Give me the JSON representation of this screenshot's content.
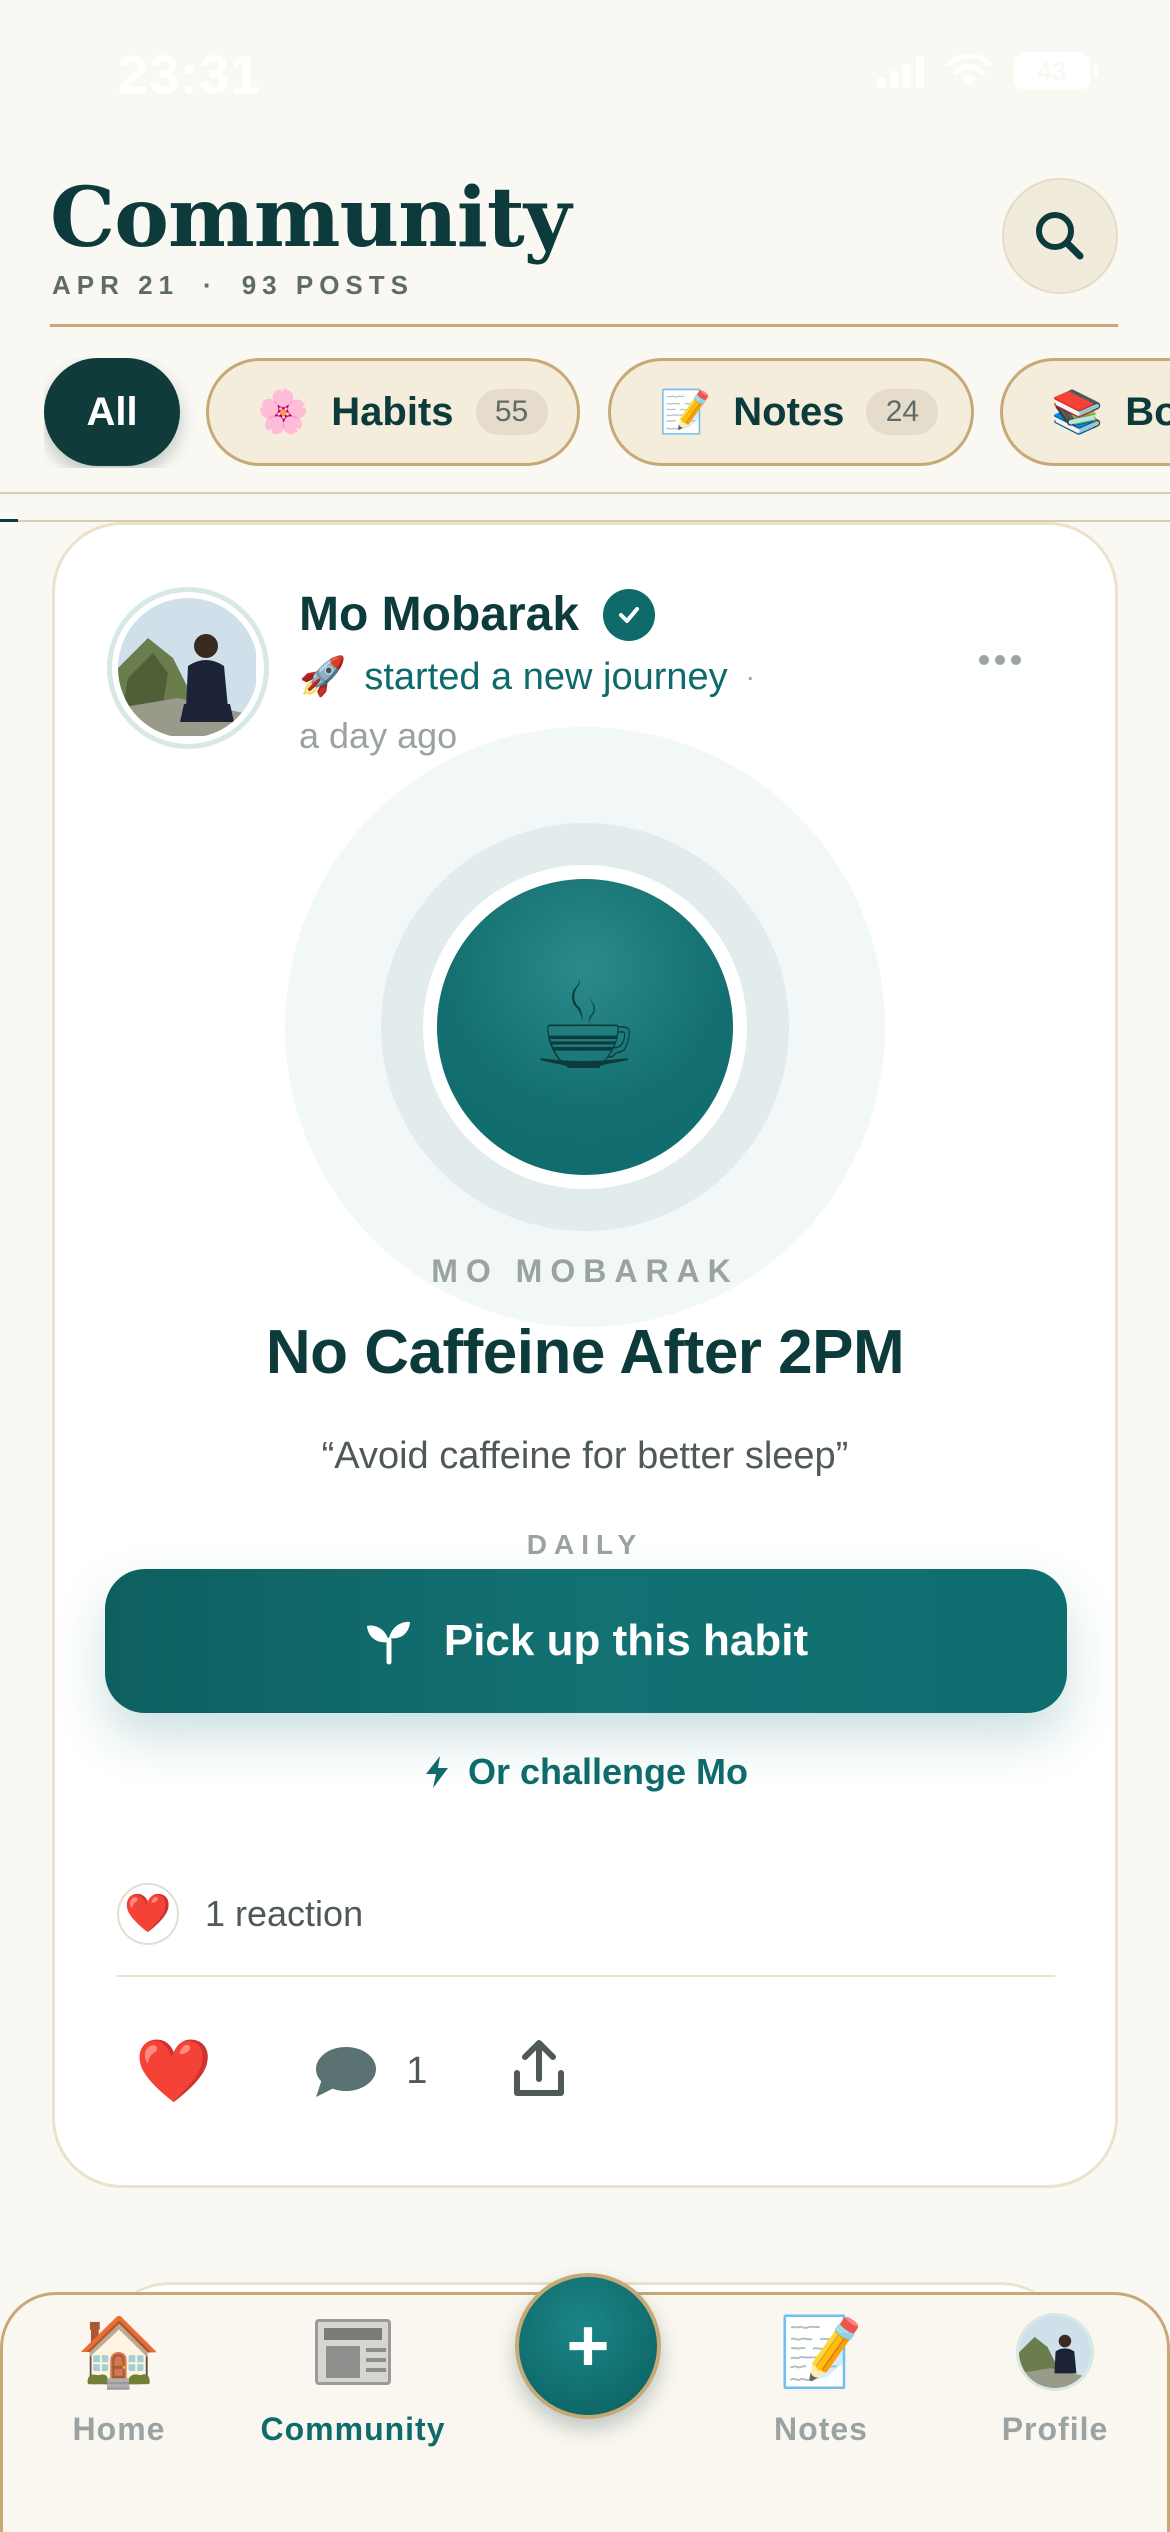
{
  "status_bar": {
    "time": "23:31",
    "battery": "43"
  },
  "header": {
    "title": "Community",
    "date": "APR 21",
    "separator": "·",
    "posts": "93 POSTS"
  },
  "filters": [
    {
      "label": "All",
      "active": true
    },
    {
      "label": "Habits",
      "emoji": "🌸",
      "count": "55"
    },
    {
      "label": "Notes",
      "emoji": "📝",
      "count": "24"
    },
    {
      "label": "Boo",
      "emoji": "📚"
    }
  ],
  "post": {
    "author": "Mo Mobarak",
    "activity_emoji": "🚀",
    "activity": "started a new journey",
    "activity_dot": "·",
    "time_ago": "a day ago",
    "habit": {
      "emoji": "☕",
      "owner": "MO MOBARAK",
      "name": "No Caffeine After 2PM",
      "quote": "“Avoid caffeine for better sleep”",
      "frequency": "DAILY"
    },
    "pick_button": "Pick up this habit",
    "challenge_link": "Or challenge Mo",
    "reaction_emoji": "❤️",
    "reactions_text": "1 reaction",
    "like_emoji": "❤️",
    "comment_count": "1"
  },
  "tabbar": {
    "home": {
      "label": "Home",
      "emoji": "🏠"
    },
    "community": {
      "label": "Community"
    },
    "add": "+",
    "notes": {
      "label": "Notes",
      "emoji": "📝"
    },
    "profile": {
      "label": "Profile"
    }
  },
  "colors": {
    "primary": "#0f6b6b",
    "dark": "#0d3b3b",
    "background": "#faf8f3",
    "gold": "#c7a978"
  }
}
